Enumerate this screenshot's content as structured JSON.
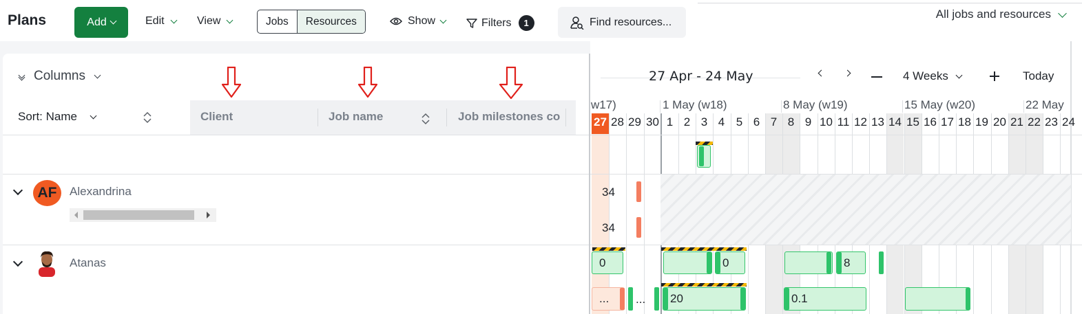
{
  "toolbar": {
    "title": "Plans",
    "add_label": "Add",
    "edit_label": "Edit",
    "view_label": "View",
    "toggle": [
      "Jobs",
      "Resources"
    ],
    "toggle_active": "Resources",
    "show_label": "Show",
    "filters_label": "Filters",
    "filters_count": "1",
    "find_label": "Find resources...",
    "scope_label": "All jobs and resources"
  },
  "left": {
    "columns_label": "Columns",
    "sort_label": "Sort: Name",
    "column_headers": [
      "Client",
      "Job name",
      "Job milestones co"
    ]
  },
  "resources": [
    {
      "name": "Alexandrina",
      "initials": "AF"
    },
    {
      "name": "Atanas"
    }
  ],
  "timeline": {
    "date_range": "27 Apr - 24 May",
    "range_select": "4 Weeks",
    "today_label": "Today",
    "weeks": [
      "w17)",
      "1 May (w18)",
      "8 May (w19)",
      "15 May (w20)",
      "22 May"
    ],
    "days": [
      "27",
      "28",
      "29",
      "30",
      "1",
      "2",
      "3",
      "4",
      "5",
      "6",
      "7",
      "8",
      "9",
      "10",
      "11",
      "12",
      "13",
      "14",
      "15",
      "16",
      "17",
      "18",
      "19",
      "20",
      "21",
      "22",
      "23",
      "24"
    ],
    "today": "27",
    "alexandrina_values": [
      "34",
      "34"
    ],
    "atanas_row1": [
      "0",
      "0",
      "8"
    ],
    "atanas_row2": [
      "...",
      "...",
      "20",
      "0.1"
    ]
  },
  "colors": {
    "brand_green": "#14803f",
    "today_orange": "#f05a22",
    "block_green": "#d2f4dc",
    "annotation_red": "#e0201b"
  }
}
